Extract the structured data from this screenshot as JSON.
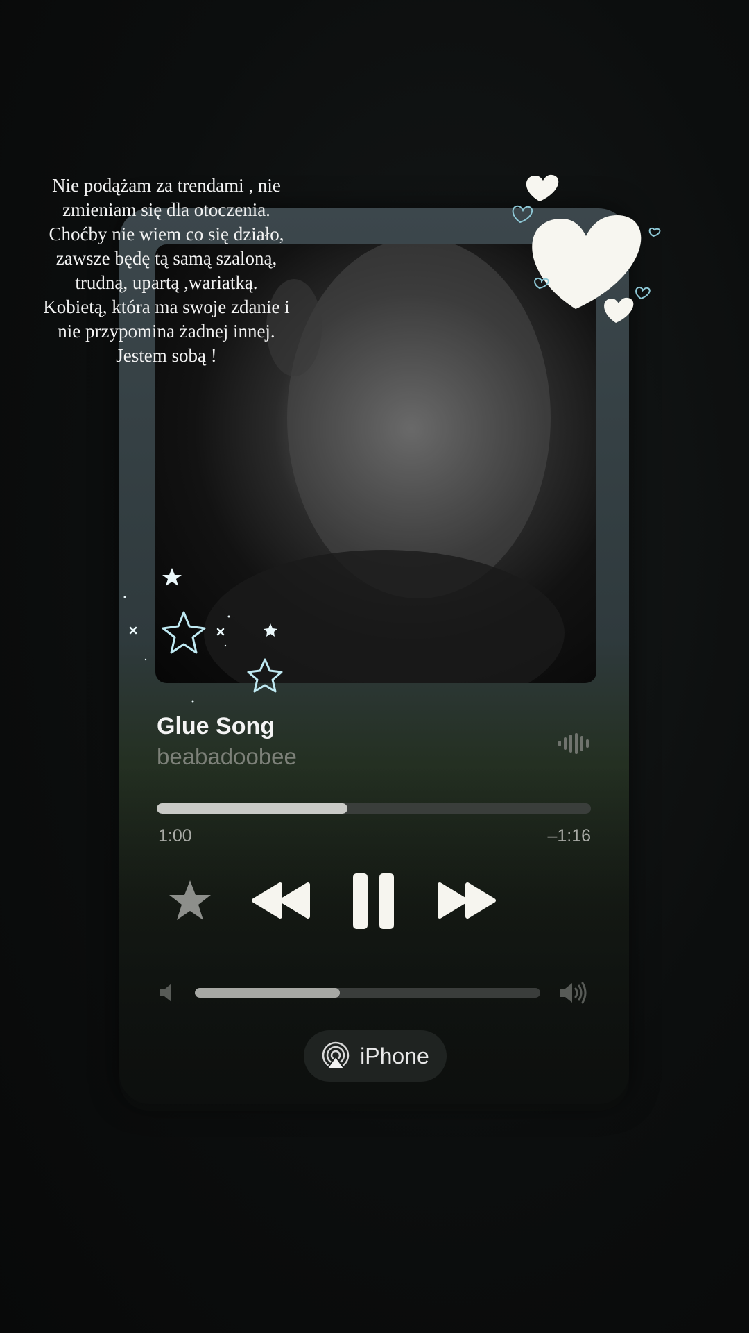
{
  "caption": {
    "text": "Nie podążam za trendami , nie\nzmieniam się dla otoczenia.\nChoćby nie wiem co się działo,\nzawsze będę tą samą szaloną,\ntrudną, upartą ,wariatką.\nKobietą, która ma swoje zdanie i\nnie przypomina żadnej innej.\nJestem sobą !"
  },
  "player": {
    "song_title": "Glue Song",
    "artist": "beabadoobee",
    "elapsed": "1:00",
    "remaining": "–1:16",
    "progress_fraction": 0.44,
    "volume_fraction": 0.42,
    "output_device": "iPhone",
    "icons": {
      "waveform": "waveform-icon",
      "favorite": "star-icon",
      "previous": "rewind-icon",
      "play_pause": "pause-icon",
      "next": "fast-forward-icon",
      "volume_low": "speaker-low-icon",
      "volume_high": "speaker-high-icon",
      "airplay": "airplay-icon"
    }
  },
  "colors": {
    "accent_light": "#f4f4f4",
    "artist_gray": "#7d8179",
    "star_outline": "#bfe9f2",
    "heart_fill": "#f7f6f0"
  }
}
